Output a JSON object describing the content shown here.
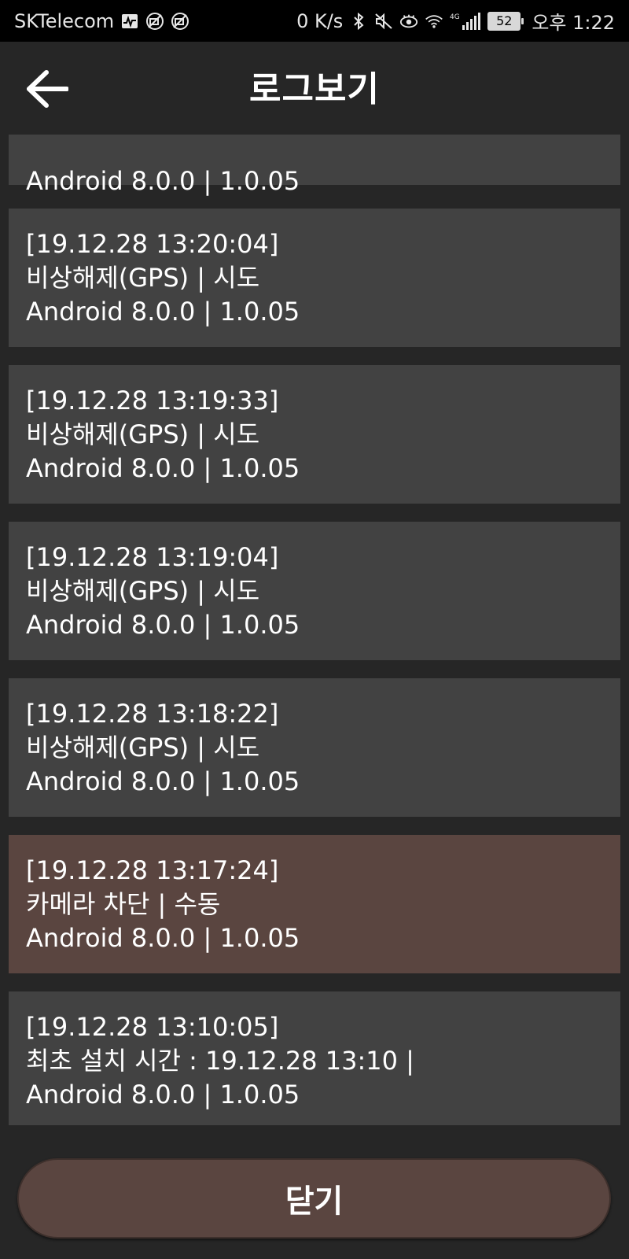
{
  "status_bar": {
    "carrier": "SKTelecom",
    "net_speed": "0 K/s",
    "network_type": "4G",
    "battery": "52",
    "time": "오후 1:22",
    "icons": [
      "activity-icon",
      "no-camera-icon",
      "no-camera-icon",
      "bluetooth-icon",
      "mute-icon",
      "eye-icon",
      "wifi-icon",
      "signal-icon"
    ]
  },
  "header": {
    "title": "로그보기",
    "back_icon": "arrow-left-icon"
  },
  "logs": [
    {
      "lines": [
        "Android 8.0.0 | 1.0.05"
      ],
      "highlight": false
    },
    {
      "lines": [
        "[19.12.28 13:20:04]",
        "비상해제(GPS) | 시도",
        "Android 8.0.0 | 1.0.05"
      ],
      "highlight": false
    },
    {
      "lines": [
        "[19.12.28 13:19:33]",
        "비상해제(GPS) | 시도",
        "Android 8.0.0 | 1.0.05"
      ],
      "highlight": false
    },
    {
      "lines": [
        "[19.12.28 13:19:04]",
        "비상해제(GPS) | 시도",
        "Android 8.0.0 | 1.0.05"
      ],
      "highlight": false
    },
    {
      "lines": [
        "[19.12.28 13:18:22]",
        "비상해제(GPS) | 시도",
        "Android 8.0.0 | 1.0.05"
      ],
      "highlight": false
    },
    {
      "lines": [
        "[19.12.28 13:17:24]",
        "카메라 차단 | 수동",
        "Android 8.0.0 | 1.0.05"
      ],
      "highlight": true
    },
    {
      "lines": [
        "[19.12.28 13:10:05]",
        "최초 설치 시간 : 19.12.28 13:10 |",
        "Android 8.0.0 | 1.0.05"
      ],
      "highlight": false
    }
  ],
  "footer": {
    "close_label": "닫기"
  },
  "colors": {
    "background": "#262626",
    "card": "#424242",
    "card_highlight": "#5a4540",
    "button": "#5a4540"
  }
}
